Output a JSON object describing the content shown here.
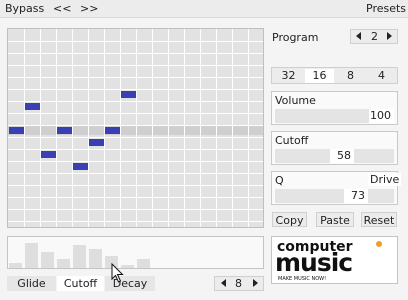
{
  "toolbar": {
    "bypass": "Bypass",
    "prev": "<<",
    "next": ">>",
    "presets": "Presets"
  },
  "program": {
    "label": "Program",
    "value": "2"
  },
  "resolution": {
    "options": [
      "32",
      "16",
      "8",
      "4"
    ],
    "selected": "16"
  },
  "volume": {
    "label": "Volume",
    "value": "100"
  },
  "cutoff": {
    "label": "Cutoff",
    "value": "58"
  },
  "q": {
    "label": "Q",
    "drive_label": "Drive",
    "value": "73"
  },
  "actions": {
    "copy": "Copy",
    "paste": "Paste",
    "reset": "Reset"
  },
  "lane_tabs": {
    "items": [
      "Glide",
      "Cutoff",
      "Decay"
    ],
    "selected": "Cutoff"
  },
  "steps": {
    "value": "8"
  },
  "logo": {
    "line1": "computer",
    "line2": "music",
    "tagline": "MAKE MUSIC NOW!"
  },
  "sequencer": {
    "steps": 16,
    "rows": 16,
    "highlight_row": 8,
    "notes": [
      [
        0,
        8
      ],
      [
        1,
        6
      ],
      [
        2,
        10
      ],
      [
        3,
        8
      ],
      [
        4,
        11
      ],
      [
        5,
        9
      ],
      [
        6,
        8
      ],
      [
        7,
        5
      ]
    ],
    "velocities": [
      0.15,
      0.8,
      0.5,
      0.3,
      0.75,
      0.6,
      0.4,
      0.1,
      0.3,
      0,
      0,
      0,
      0,
      0,
      0,
      0
    ]
  },
  "colors": {
    "note": "#3a40b4",
    "grid_bg": "#e2e2e2",
    "grid_line": "#ffffff",
    "logo_accent": "#f0a020"
  }
}
